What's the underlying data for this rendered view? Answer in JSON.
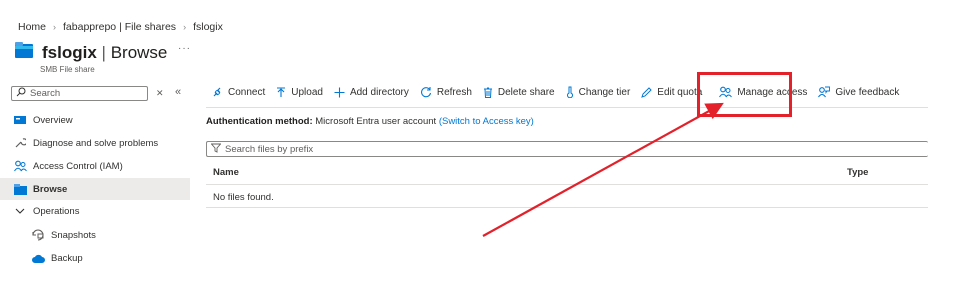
{
  "breadcrumb": [
    "Home",
    "fabapprepo | File shares",
    "fslogix"
  ],
  "header": {
    "name": "fslogix",
    "separator": "|",
    "view": "Browse",
    "subtitle": "SMB File share",
    "more": "···"
  },
  "sidebar": {
    "search_placeholder": "Search",
    "items": [
      {
        "label": "Overview",
        "icon": "overview-icon"
      },
      {
        "label": "Diagnose and solve problems",
        "icon": "wrench-icon"
      },
      {
        "label": "Access Control (IAM)",
        "icon": "people-icon"
      },
      {
        "label": "Browse",
        "icon": "folder-icon",
        "selected": true
      },
      {
        "label": "Operations",
        "icon": "chevron-down-icon"
      },
      {
        "label": "Snapshots",
        "icon": "snapshot-icon"
      },
      {
        "label": "Backup",
        "icon": "cloud-backup-icon"
      }
    ]
  },
  "toolbar": {
    "connect": "Connect",
    "upload": "Upload",
    "add_directory": "Add directory",
    "refresh": "Refresh",
    "delete_share": "Delete share",
    "change_tier": "Change tier",
    "edit_quota": "Edit quota",
    "manage_access": "Manage access",
    "give_feedback": "Give feedback"
  },
  "auth": {
    "label": "Authentication method:",
    "value": "Microsoft Entra user account",
    "switch_link": "(Switch to Access key)"
  },
  "filter_placeholder": "Search files by prefix",
  "table": {
    "col_name": "Name",
    "col_type": "Type",
    "empty": "No files found."
  },
  "colors": {
    "accent": "#0078d4",
    "annotation": "#e3212b",
    "selected_bg": "#edebe9"
  }
}
